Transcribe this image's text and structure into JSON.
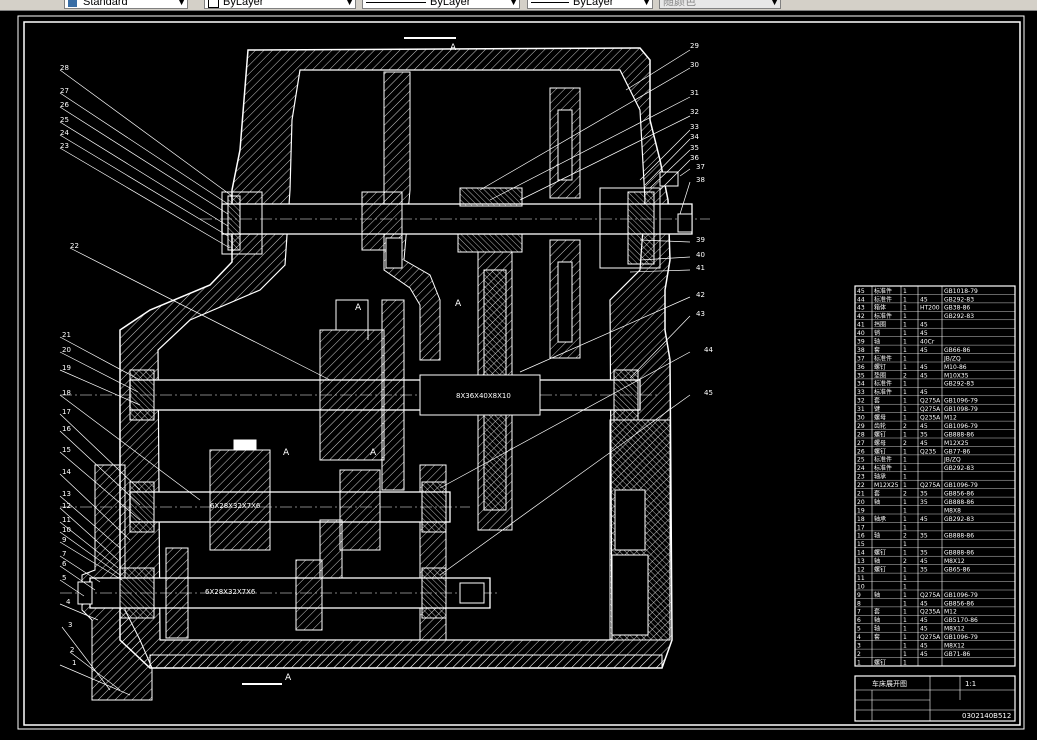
{
  "toolbar": {
    "text_style": "Standard",
    "layer": "ByLayer",
    "linetype": "ByLayer",
    "lineweight": "ByLayer",
    "plot_style": "随颜色"
  },
  "drawing": {
    "section_labels": [
      "A",
      "A",
      "A",
      "A",
      "A",
      "A"
    ],
    "left_callouts": [
      "28",
      "27",
      "26",
      "25",
      "24",
      "23",
      "22",
      "21",
      "20",
      "19",
      "18",
      "17",
      "16",
      "15",
      "14",
      "13",
      "12",
      "11",
      "10",
      "9",
      "7",
      "6",
      "5",
      "4",
      "3",
      "2",
      "1"
    ],
    "right_callouts": [
      "29",
      "30",
      "31",
      "32",
      "33",
      "34",
      "35",
      "36",
      "37",
      "38",
      "39",
      "40",
      "41",
      "42",
      "43",
      "44",
      "45"
    ],
    "spline_label_1": "8X36X40X8X10",
    "spline_label_2": "6X28X32X7X6",
    "spline_label_3": "6X28X32X7X6"
  },
  "bom": {
    "rows": [
      [
        "45",
        "标准件",
        "1",
        "",
        "GB1018-79"
      ],
      [
        "44",
        "标准件",
        "1",
        "45",
        "GB292-83"
      ],
      [
        "43",
        "箱体",
        "1",
        "HT200",
        "GB38-86"
      ],
      [
        "42",
        "标准件",
        "1",
        "",
        "GB292-83"
      ],
      [
        "41",
        "挡圈",
        "1",
        "45",
        ""
      ],
      [
        "40",
        "销",
        "1",
        "45",
        ""
      ],
      [
        "39",
        "轴",
        "1",
        "40Cr",
        ""
      ],
      [
        "38",
        "套",
        "1",
        "45",
        "GB66-86"
      ],
      [
        "37",
        "标准件",
        "1",
        "",
        "JB/ZQ"
      ],
      [
        "36",
        "螺钉",
        "1",
        "45",
        "M10-86"
      ],
      [
        "35",
        "垫圈",
        "2",
        "45",
        "M10X35"
      ],
      [
        "34",
        "标准件",
        "1",
        "",
        "GB292-83"
      ],
      [
        "33",
        "标准件",
        "1",
        "45",
        ""
      ],
      [
        "32",
        "套",
        "1",
        "Q275A",
        "GB1096-79"
      ],
      [
        "31",
        "键",
        "1",
        "Q275A",
        "GB1098-79"
      ],
      [
        "30",
        "螺母",
        "1",
        "Q235A",
        "M12"
      ],
      [
        "29",
        "齿轮",
        "2",
        "45",
        "GB1096-79"
      ],
      [
        "28",
        "螺钉",
        "1",
        "35",
        "GB888-86"
      ],
      [
        "27",
        "螺母",
        "2",
        "45",
        "M12X25"
      ],
      [
        "26",
        "螺钉",
        "1",
        "Q235",
        "GB77-86"
      ],
      [
        "25",
        "标准件",
        "1",
        "",
        "JB/ZQ"
      ],
      [
        "24",
        "标准件",
        "1",
        "",
        "GB292-83"
      ],
      [
        "23",
        "轴承",
        "1",
        "",
        ""
      ],
      [
        "22",
        "M12X25",
        "1",
        "Q275A",
        "GB1096-79"
      ],
      [
        "21",
        "套",
        "2",
        "35",
        "GB856-86"
      ],
      [
        "20",
        "轴",
        "1",
        "35",
        "GB888-86"
      ],
      [
        "19",
        "",
        "1",
        "",
        "M8X8"
      ],
      [
        "18",
        "轴承",
        "1",
        "45",
        "GB292-83"
      ],
      [
        "17",
        "",
        "1",
        "",
        ""
      ],
      [
        "16",
        "轴",
        "2",
        "35",
        "GB888-86"
      ],
      [
        "15",
        "",
        "1",
        "",
        ""
      ],
      [
        "14",
        "螺钉",
        "1",
        "35",
        "GB888-86"
      ],
      [
        "13",
        "轴",
        "2",
        "45",
        "M8X12"
      ],
      [
        "12",
        "螺钉",
        "1",
        "35",
        "GB65-86"
      ],
      [
        "11",
        "",
        "1",
        "",
        ""
      ],
      [
        "10",
        "",
        "1",
        "",
        ""
      ],
      [
        "9",
        "轴",
        "1",
        "Q275A",
        "GB1096-79"
      ],
      [
        "8",
        "",
        "1",
        "45",
        "GB856-86"
      ],
      [
        "7",
        "套",
        "1",
        "Q235A",
        "M12"
      ],
      [
        "6",
        "轴",
        "1",
        "45",
        "GB5170-86"
      ],
      [
        "5",
        "轴",
        "1",
        "45",
        "M8X12"
      ],
      [
        "4",
        "套",
        "1",
        "Q275A",
        "GB1096-79"
      ],
      [
        "3",
        "",
        "1",
        "45",
        "M8X12"
      ],
      [
        "2",
        "",
        "1",
        "45",
        "GB71-86"
      ],
      [
        "1",
        "螺钉",
        "1",
        "",
        ""
      ]
    ],
    "title_block": {
      "name": "车床展开图",
      "scale": "1:1",
      "drawing_no": "0302140B512"
    }
  }
}
